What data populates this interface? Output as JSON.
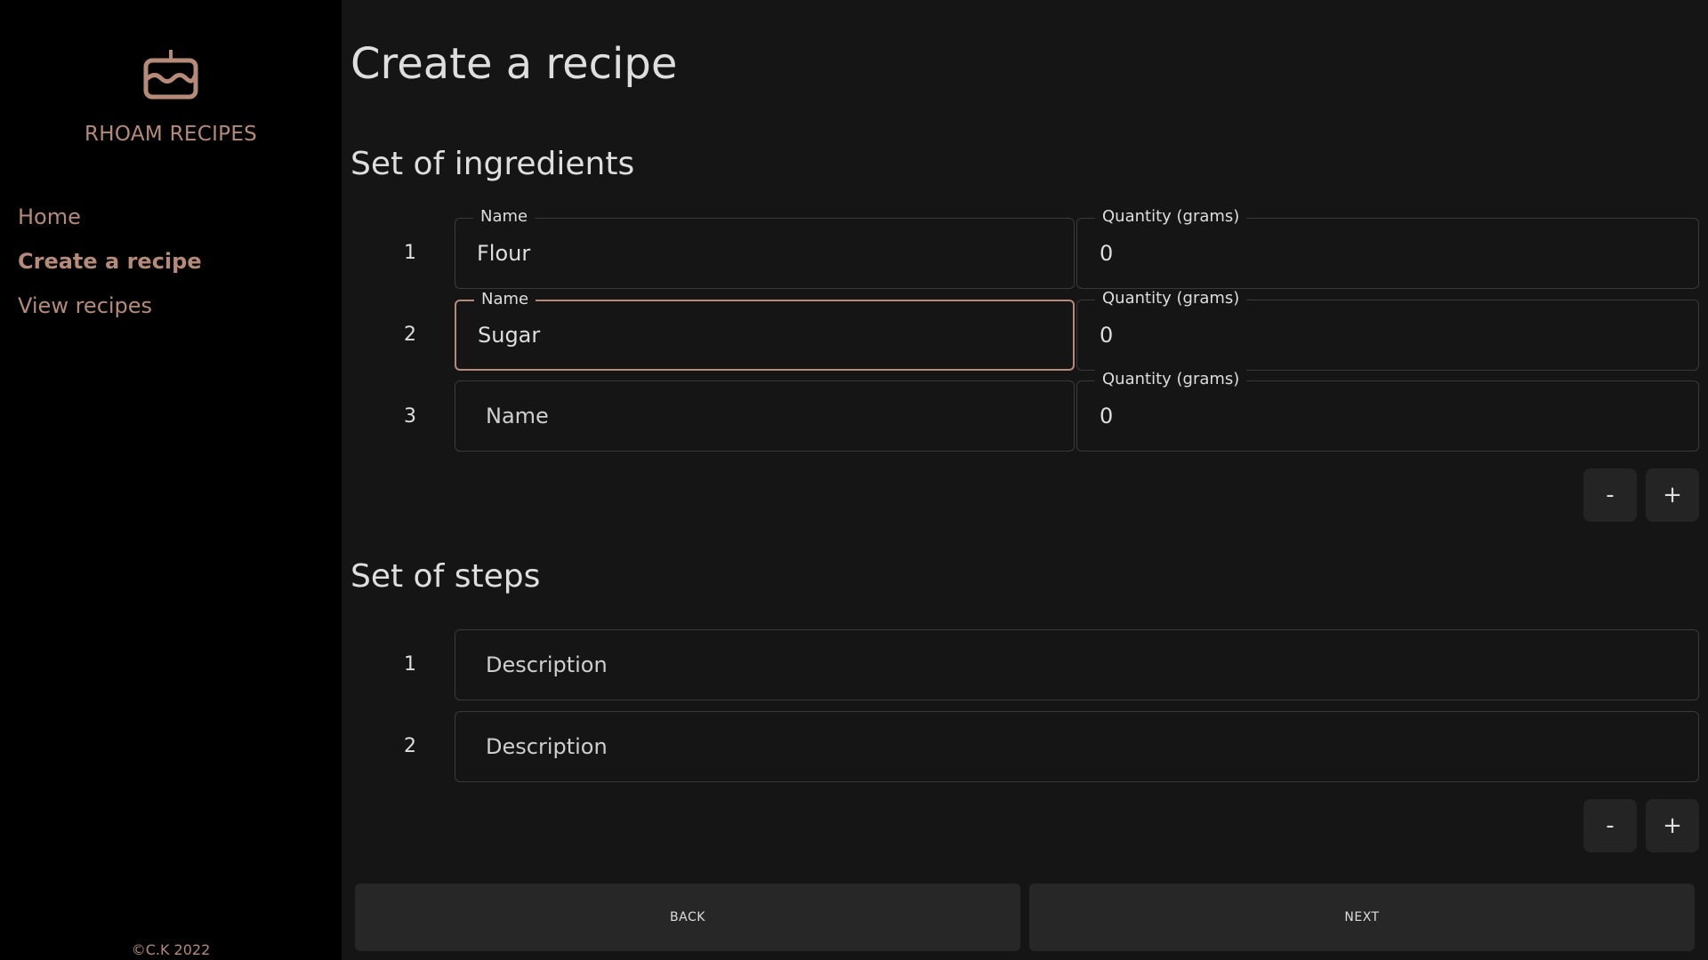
{
  "sidebar": {
    "logo_icon": "cake-icon",
    "brand": "RHOAM RECIPES",
    "nav": {
      "home": "Home",
      "create": "Create a recipe",
      "view": "View recipes"
    },
    "copyright": "©C.K 2022",
    "accent_color": "#b58a78"
  },
  "main": {
    "title": "Create a recipe",
    "ingredients": {
      "heading": "Set of ingredients",
      "rows": [
        {
          "num": "1",
          "name_label": "Name",
          "name_value": "Flour",
          "qty_label": "Quantity (grams)",
          "qty_value": "0"
        },
        {
          "num": "2",
          "name_label": "Name",
          "name_value": "Sugar",
          "qty_label": "Quantity (grams)",
          "qty_value": "0"
        },
        {
          "num": "3",
          "name_placeholder": "Name",
          "qty_label": "Quantity (grams)",
          "qty_value": "0"
        }
      ],
      "remove_label": "-",
      "add_label": "+"
    },
    "steps": {
      "heading": "Set of steps",
      "rows": [
        {
          "num": "1",
          "placeholder": "Description"
        },
        {
          "num": "2",
          "placeholder": "Description"
        }
      ],
      "remove_label": "-",
      "add_label": "+"
    },
    "back_label": "BACK",
    "next_label": "NEXT"
  }
}
